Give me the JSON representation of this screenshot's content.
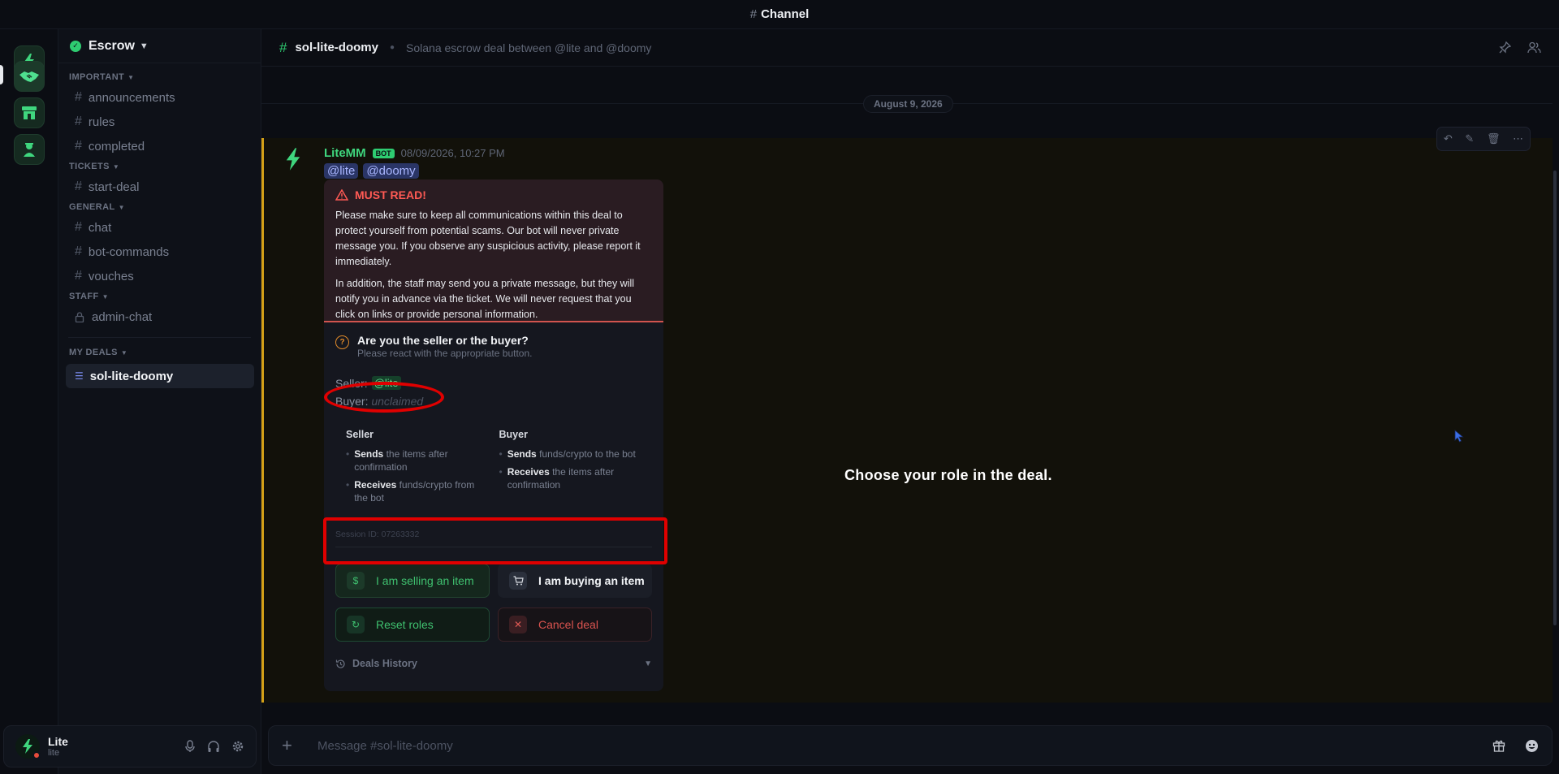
{
  "window": {
    "title": "Channel"
  },
  "server": {
    "name": "Escrow"
  },
  "sidebar": {
    "categories": [
      {
        "label": "IMPORTANT",
        "channels": [
          {
            "name": "announcements",
            "icon": "hash"
          },
          {
            "name": "rules",
            "icon": "hash"
          },
          {
            "name": "completed",
            "icon": "hash"
          }
        ]
      },
      {
        "label": "TICKETS",
        "channels": [
          {
            "name": "start-deal",
            "icon": "hash"
          }
        ]
      },
      {
        "label": "GENERAL",
        "channels": [
          {
            "name": "chat",
            "icon": "hash"
          },
          {
            "name": "bot-commands",
            "icon": "hash"
          },
          {
            "name": "vouches",
            "icon": "hash"
          }
        ]
      },
      {
        "label": "STAFF",
        "channels": [
          {
            "name": "admin-chat",
            "icon": "lock"
          }
        ]
      }
    ],
    "my_deals": {
      "label": "MY DEALS",
      "selected": "sol-lite-doomy"
    }
  },
  "user_panel": {
    "display_name": "Lite",
    "username": "lite",
    "status": "dnd"
  },
  "channel_header": {
    "name": "sol-lite-doomy",
    "topic": "Solana escrow deal between @lite and @doomy"
  },
  "date_separator": "August 9, 2026",
  "message": {
    "author": "LiteMM",
    "badge": "BOT",
    "timestamp": "08/09/2026, 10:27 PM",
    "mentions": [
      "@lite",
      "@doomy"
    ],
    "accent_color": "#d4a017",
    "embed": {
      "warning_title": "MUST READ!",
      "warning_p1": "Please make sure to keep all communications within this deal to protect yourself from potential scams. Our bot will never private message you. If you observe any suspicious activity, please report it immediately.",
      "warning_p2": "In addition, the staff may send you a private message, but they will notify you in advance via the ticket. We will never request that you click on links or provide personal information.",
      "question_title": "Are you the seller or the buyer?",
      "question_sub": "Please react with the appropriate button.",
      "seller_label": "Seller:",
      "seller_value": "@lite",
      "buyer_label": "Buyer:",
      "buyer_value": "unclaimed",
      "seller_col": {
        "title": "Seller",
        "i1_bold": "Sends",
        "i1_rest": "the items after confirmation",
        "i2_bold": "Receives",
        "i2_rest": "funds/crypto from the bot"
      },
      "buyer_col": {
        "title": "Buyer",
        "i1_bold": "Sends",
        "i1_rest": "funds/crypto to the bot",
        "i2_bold": "Receives",
        "i2_rest": "the items after confirmation"
      },
      "session": "Session ID: 07263332",
      "buttons": {
        "sell": "I am selling an item",
        "buy": "I am buying an item",
        "reset": "Reset roles",
        "cancel": "Cancel deal"
      },
      "history": "Deals History"
    }
  },
  "annotation": {
    "text": "Choose your role in the deal."
  },
  "composer": {
    "placeholder": "Message #sol-lite-doomy"
  }
}
